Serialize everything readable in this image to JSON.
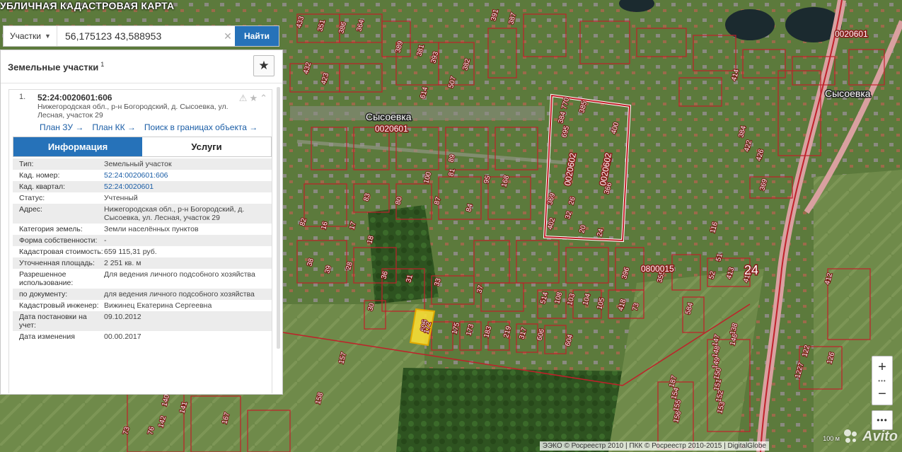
{
  "app": {
    "title": "УБЛИЧНАЯ КАДАСТРОВАЯ КАРТА"
  },
  "search": {
    "type_label": "Участки",
    "query": "56,175123 43,588953",
    "find_label": "Найти"
  },
  "panel": {
    "title": "Земельные участки",
    "count": "1"
  },
  "result": {
    "number": "1.",
    "cadnum": "52:24:0020601:606",
    "address": "Нижегородская обл., р-н Богородский, д. Сысоевка, ул. Лесная, участок 29",
    "links": [
      "План ЗУ →",
      "План КК →",
      "Поиск в границах объекта →"
    ],
    "tabs": {
      "info": "Информация",
      "services": "Услуги"
    },
    "props": [
      {
        "label": "Тип:",
        "value": "Земельный участок"
      },
      {
        "label": "Кад. номер:",
        "value": "52:24:0020601:606",
        "link": true
      },
      {
        "label": "Кад. квартал:",
        "value": "52:24:0020601",
        "link": true
      },
      {
        "label": "Статус:",
        "value": "Учтенный"
      },
      {
        "label": "Адрес:",
        "value": "Нижегородская обл., р-н Богородский, д. Сысоевка, ул. Лесная, участок 29"
      },
      {
        "label": "Категория земель:",
        "value": "Земли населённых пунктов"
      },
      {
        "label": "Форма собственности:",
        "value": "-"
      },
      {
        "label": "Кадастровая стоимость:",
        "value": "659 115,31 руб."
      },
      {
        "label": "Уточненная площадь:",
        "value": "2 251 кв. м"
      },
      {
        "label": "Разрешенное использование:",
        "value": "Для ведения личного подсобного хозяйства"
      },
      {
        "label": "по документу:",
        "value": "для ведения личного подсобного хозяйства"
      },
      {
        "label": "Кадастровый инженер:",
        "value": "Вижинец Екатерина Сергеевна"
      },
      {
        "label": "Дата постановки на учет:",
        "value": "09.10.2012"
      },
      {
        "label": "Дата изменения",
        "value": "00.00.2017"
      }
    ]
  },
  "map": {
    "place_labels": [
      "Сысоевка",
      "Сысоевка"
    ],
    "block_labels": [
      "0020601",
      "0020601",
      "0020602",
      "0020602",
      "0800015"
    ],
    "big_labels": [
      "24"
    ],
    "parcel_labels": [
      "433",
      "351",
      "386",
      "364",
      "432",
      "423",
      "389",
      "381",
      "393",
      "507",
      "614",
      "382",
      "391",
      "387",
      "414",
      "384",
      "422",
      "426",
      "369",
      "116",
      "51",
      "52",
      "413",
      "414",
      "412",
      "126",
      "122",
      "1227",
      "187",
      "138",
      "146",
      "147",
      "148",
      "149",
      "150",
      "151",
      "152",
      "153",
      "154",
      "155",
      "156",
      "157",
      "158",
      "140",
      "141",
      "142",
      "73",
      "76",
      "167",
      "172",
      "175",
      "173",
      "183",
      "219",
      "317",
      "606",
      "604",
      "514",
      "108",
      "103",
      "104",
      "105",
      "418",
      "73",
      "584",
      "396",
      "355",
      "770",
      "385",
      "384",
      "695",
      "400",
      "392",
      "366",
      "369",
      "402",
      "20",
      "24",
      "26",
      "32",
      "33",
      "31",
      "36",
      "37",
      "30",
      "38",
      "39",
      "28",
      "18",
      "17",
      "16",
      "82",
      "83",
      "80",
      "81",
      "95",
      "168",
      "84",
      "87",
      "100",
      "89",
      "94",
      "93",
      "92",
      "128",
      "178",
      "195",
      "196",
      "198",
      "189",
      "184",
      "186",
      "191",
      "192"
    ],
    "scale": "100 м"
  },
  "attribution": "ЭЭКО © Росреестр 2010 | ПКК © Росреестр 2010-2015 | DigitalGlobe",
  "watermark": "Avito",
  "zoom": {
    "in": "+",
    "out": "−"
  },
  "icons": {
    "search_type_caret": "caret-down-icon",
    "clear": "close-icon",
    "favorite": "star-icon",
    "result_warning": "warning-icon",
    "result_star": "star-outline-icon",
    "result_collapse": "chevron-up-icon"
  },
  "colors": {
    "accent": "#2672b9",
    "link": "#1a5da6",
    "parcel_border": "#c0202a",
    "selected_parcel": "#ffe033"
  }
}
